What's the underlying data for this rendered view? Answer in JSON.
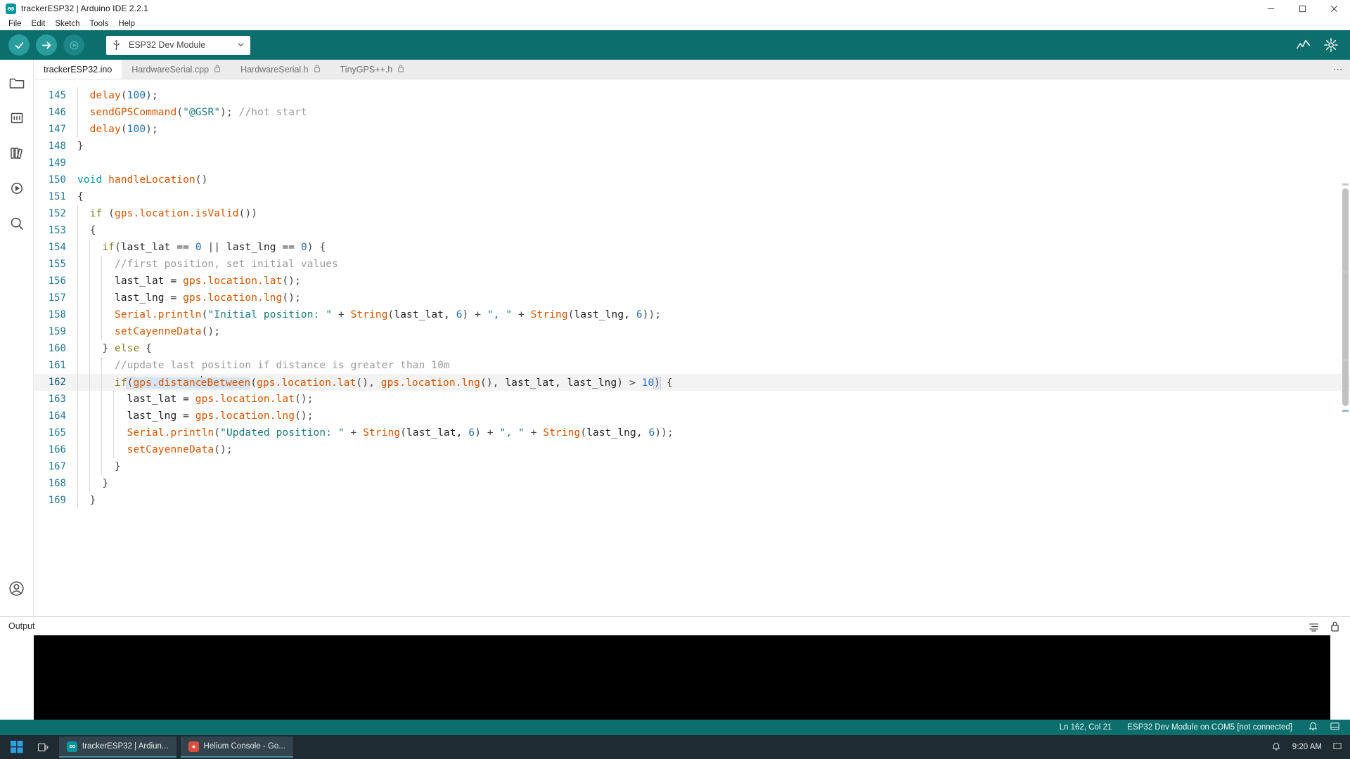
{
  "window": {
    "title": "trackerESP32 | Arduino IDE 2.2.1",
    "logo_icon": "arduino-infinity-icon",
    "minimize_label": "—",
    "maximize_label": "❐",
    "close_label": "✕"
  },
  "menubar": {
    "items": [
      {
        "label": "File"
      },
      {
        "label": "Edit"
      },
      {
        "label": "Sketch"
      },
      {
        "label": "Tools"
      },
      {
        "label": "Help"
      }
    ]
  },
  "toolbar": {
    "verify_icon": "checkmark-icon",
    "verify_label": "Verify",
    "upload_icon": "arrow-right-icon",
    "upload_label": "Upload",
    "debug_icon": "debug-icon",
    "debug_label": "Debug",
    "board_usb_icon": "usb-icon",
    "board_value": "ESP32 Dev Module",
    "board_caret_icon": "chevron-down-icon",
    "serial_plotter_icon": "serial-plotter-icon",
    "serial_monitor_icon": "serial-monitor-icon",
    "accent_color": "#0d6e6e",
    "button_color": "#2a9d9d"
  },
  "activitybar": {
    "items": [
      {
        "icon": "sketchbook-folder-icon",
        "name": "sketchbook"
      },
      {
        "icon": "boards-manager-icon",
        "name": "boards-manager"
      },
      {
        "icon": "library-manager-icon",
        "name": "library-manager"
      },
      {
        "icon": "debug-icon",
        "name": "debug"
      },
      {
        "icon": "search-icon",
        "name": "search"
      }
    ],
    "account_icon": "account-icon"
  },
  "tabs": {
    "more_label": "⋯",
    "items": [
      {
        "label": "trackerESP32.ino",
        "locked": false,
        "active": true
      },
      {
        "label": "HardwareSerial.cpp",
        "locked": true,
        "active": false
      },
      {
        "label": "HardwareSerial.h",
        "locked": true,
        "active": false
      },
      {
        "label": "TinyGPS++.h",
        "locked": true,
        "active": false
      }
    ],
    "lock_icon": "lock-icon"
  },
  "editor": {
    "first_visible_line": 145,
    "current_line": 162,
    "lines": [
      {
        "n": 145,
        "indent": 1,
        "tokens": [
          {
            "t": "delay",
            "c": "t-fn"
          },
          {
            "t": "(",
            "c": "t-pn"
          },
          {
            "t": "100",
            "c": "t-num"
          },
          {
            "t": ");",
            "c": "t-pn"
          }
        ]
      },
      {
        "n": 146,
        "indent": 1,
        "tokens": [
          {
            "t": "sendGPSCommand",
            "c": "t-fn"
          },
          {
            "t": "(",
            "c": "t-pn"
          },
          {
            "t": "\"@GSR\"",
            "c": "t-str"
          },
          {
            "t": "); ",
            "c": "t-pn"
          },
          {
            "t": "//hot start",
            "c": "t-cmt"
          }
        ]
      },
      {
        "n": 147,
        "indent": 1,
        "tokens": [
          {
            "t": "delay",
            "c": "t-fn"
          },
          {
            "t": "(",
            "c": "t-pn"
          },
          {
            "t": "100",
            "c": "t-num"
          },
          {
            "t": ");",
            "c": "t-pn"
          }
        ]
      },
      {
        "n": 148,
        "indent": 0,
        "tokens": [
          {
            "t": "}",
            "c": "t-pn"
          }
        ]
      },
      {
        "n": 149,
        "indent": 0,
        "tokens": []
      },
      {
        "n": 150,
        "indent": 0,
        "tokens": [
          {
            "t": "void",
            "c": "t-kw"
          },
          {
            "t": " ",
            "c": "t-id"
          },
          {
            "t": "handleLocation",
            "c": "t-fn"
          },
          {
            "t": "()",
            "c": "t-pn"
          }
        ]
      },
      {
        "n": 151,
        "indent": 0,
        "tokens": [
          {
            "t": "{",
            "c": "t-pn"
          }
        ]
      },
      {
        "n": 152,
        "indent": 1,
        "tokens": [
          {
            "t": "if",
            "c": "t-ctl"
          },
          {
            "t": " (",
            "c": "t-pn"
          },
          {
            "t": "gps.location.isValid",
            "c": "t-fn"
          },
          {
            "t": "())",
            "c": "t-pn"
          }
        ]
      },
      {
        "n": 153,
        "indent": 1,
        "tokens": [
          {
            "t": "{",
            "c": "t-pn"
          }
        ]
      },
      {
        "n": 154,
        "indent": 2,
        "tokens": [
          {
            "t": "if",
            "c": "t-ctl"
          },
          {
            "t": "(",
            "c": "t-pn"
          },
          {
            "t": "last_lat ",
            "c": "t-id"
          },
          {
            "t": "== ",
            "c": "t-pn"
          },
          {
            "t": "0",
            "c": "t-num"
          },
          {
            "t": " || ",
            "c": "t-pn"
          },
          {
            "t": "last_lng ",
            "c": "t-id"
          },
          {
            "t": "== ",
            "c": "t-pn"
          },
          {
            "t": "0",
            "c": "t-num"
          },
          {
            "t": ") {",
            "c": "t-pn"
          }
        ]
      },
      {
        "n": 155,
        "indent": 3,
        "tokens": [
          {
            "t": "//first position, set initial values",
            "c": "t-cmt"
          }
        ]
      },
      {
        "n": 156,
        "indent": 3,
        "tokens": [
          {
            "t": "last_lat = ",
            "c": "t-id"
          },
          {
            "t": "gps.location.lat",
            "c": "t-fn"
          },
          {
            "t": "();",
            "c": "t-pn"
          }
        ]
      },
      {
        "n": 157,
        "indent": 3,
        "tokens": [
          {
            "t": "last_lng = ",
            "c": "t-id"
          },
          {
            "t": "gps.location.lng",
            "c": "t-fn"
          },
          {
            "t": "();",
            "c": "t-pn"
          }
        ]
      },
      {
        "n": 158,
        "indent": 3,
        "tokens": [
          {
            "t": "Serial.println",
            "c": "t-fn"
          },
          {
            "t": "(",
            "c": "t-pn"
          },
          {
            "t": "\"Initial position: \"",
            "c": "t-str"
          },
          {
            "t": " + ",
            "c": "t-pn"
          },
          {
            "t": "String",
            "c": "t-fn"
          },
          {
            "t": "(",
            "c": "t-pn"
          },
          {
            "t": "last_lat, ",
            "c": "t-id"
          },
          {
            "t": "6",
            "c": "t-num"
          },
          {
            "t": ") + ",
            "c": "t-pn"
          },
          {
            "t": "\", \"",
            "c": "t-str"
          },
          {
            "t": " + ",
            "c": "t-pn"
          },
          {
            "t": "String",
            "c": "t-fn"
          },
          {
            "t": "(",
            "c": "t-pn"
          },
          {
            "t": "last_lng, ",
            "c": "t-id"
          },
          {
            "t": "6",
            "c": "t-num"
          },
          {
            "t": "));",
            "c": "t-pn"
          }
        ]
      },
      {
        "n": 159,
        "indent": 3,
        "tokens": [
          {
            "t": "setCayenneData",
            "c": "t-fn"
          },
          {
            "t": "();",
            "c": "t-pn"
          }
        ]
      },
      {
        "n": 160,
        "indent": 2,
        "tokens": [
          {
            "t": "} ",
            "c": "t-pn"
          },
          {
            "t": "else",
            "c": "t-ctl"
          },
          {
            "t": " {",
            "c": "t-pn"
          }
        ]
      },
      {
        "n": 161,
        "indent": 3,
        "tokens": [
          {
            "t": "//update last position if distance is greater than 10m",
            "c": "t-cmt"
          }
        ]
      },
      {
        "n": 162,
        "indent": 3,
        "current": true,
        "tokens": [
          {
            "t": "if",
            "c": "t-ctl"
          },
          {
            "t": "(",
            "c": "t-pn",
            "bracket": true
          },
          {
            "t": "gps.distanc",
            "c": "t-fn",
            "sel": true
          },
          {
            "t": "CARET",
            "c": "caret"
          },
          {
            "t": "eBetween",
            "c": "t-fn",
            "sel": true
          },
          {
            "t": "(",
            "c": "t-pn"
          },
          {
            "t": "gps.location.lat",
            "c": "t-fn"
          },
          {
            "t": "(), ",
            "c": "t-pn"
          },
          {
            "t": "gps.location.lng",
            "c": "t-fn"
          },
          {
            "t": "(), ",
            "c": "t-pn"
          },
          {
            "t": "last_lat, last_lng",
            "c": "t-id"
          },
          {
            "t": ") > ",
            "c": "t-pn"
          },
          {
            "t": "10",
            "c": "t-num"
          },
          {
            "t": ")",
            "c": "t-pn",
            "bracket": true
          },
          {
            "t": " {",
            "c": "t-pn"
          }
        ]
      },
      {
        "n": 163,
        "indent": 4,
        "tokens": [
          {
            "t": "last_lat = ",
            "c": "t-id"
          },
          {
            "t": "gps.location.lat",
            "c": "t-fn"
          },
          {
            "t": "();",
            "c": "t-pn"
          }
        ]
      },
      {
        "n": 164,
        "indent": 4,
        "tokens": [
          {
            "t": "last_lng = ",
            "c": "t-id"
          },
          {
            "t": "gps.location.lng",
            "c": "t-fn"
          },
          {
            "t": "();",
            "c": "t-pn"
          }
        ]
      },
      {
        "n": 165,
        "indent": 4,
        "tokens": [
          {
            "t": "Serial.println",
            "c": "t-fn"
          },
          {
            "t": "(",
            "c": "t-pn"
          },
          {
            "t": "\"Updated position: \"",
            "c": "t-str"
          },
          {
            "t": " + ",
            "c": "t-pn"
          },
          {
            "t": "String",
            "c": "t-fn"
          },
          {
            "t": "(",
            "c": "t-pn"
          },
          {
            "t": "last_lat, ",
            "c": "t-id"
          },
          {
            "t": "6",
            "c": "t-num"
          },
          {
            "t": ") + ",
            "c": "t-pn"
          },
          {
            "t": "\", \"",
            "c": "t-str"
          },
          {
            "t": " + ",
            "c": "t-pn"
          },
          {
            "t": "String",
            "c": "t-fn"
          },
          {
            "t": "(",
            "c": "t-pn"
          },
          {
            "t": "last_lng, ",
            "c": "t-id"
          },
          {
            "t": "6",
            "c": "t-num"
          },
          {
            "t": "));",
            "c": "t-pn"
          }
        ]
      },
      {
        "n": 166,
        "indent": 4,
        "tokens": [
          {
            "t": "setCayenneData",
            "c": "t-fn"
          },
          {
            "t": "();",
            "c": "t-pn"
          }
        ]
      },
      {
        "n": 167,
        "indent": 3,
        "tokens": [
          {
            "t": "}",
            "c": "t-pn"
          }
        ]
      },
      {
        "n": 168,
        "indent": 2,
        "tokens": [
          {
            "t": "}",
            "c": "t-pn"
          }
        ]
      },
      {
        "n": 169,
        "indent": 1,
        "tokens": [
          {
            "t": "}",
            "c": "t-pn"
          }
        ]
      }
    ]
  },
  "output": {
    "title": "Output",
    "clear_icon": "clear-output-icon",
    "lock_icon": "scroll-lock-icon",
    "console_text": ""
  },
  "statusbar": {
    "cursor_position": "Ln 162, Col 21",
    "board_status": "ESP32 Dev Module on COM5 [not connected]",
    "notification_icon": "bell-icon",
    "panel_icon": "toggle-panel-icon"
  },
  "taskbar": {
    "start_icon": "windows-start-icon",
    "search_icon": "taskview-icon",
    "tasks": [
      {
        "label": "trackerESP32 | Ardiun...",
        "icon": "arduino-icon",
        "icon_color": "#00979c"
      },
      {
        "label": "Helium Console - Go...",
        "icon": "chrome-icon",
        "icon_color": "#d94f3d"
      }
    ],
    "clock": "9:20 AM",
    "tray_icons": [
      "notification-icon",
      "show-desktop-icon"
    ]
  }
}
